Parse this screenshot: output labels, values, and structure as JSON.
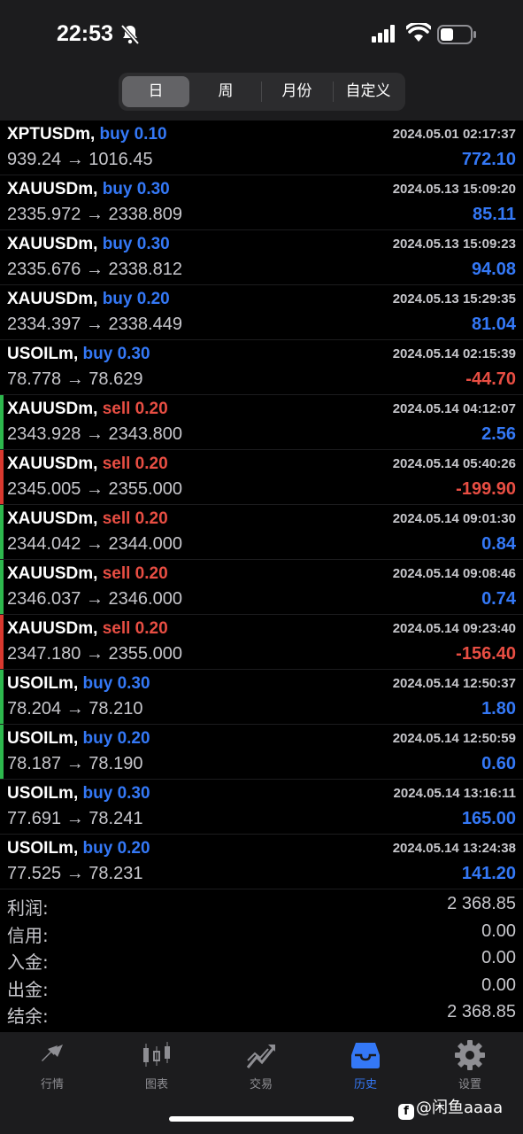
{
  "status": {
    "time": "22:53"
  },
  "segment": {
    "items": [
      "日",
      "周",
      "月份",
      "自定义"
    ],
    "active": 0
  },
  "deals": [
    {
      "symbol": "XPTUSDm",
      "side": "buy",
      "volume": "0.10",
      "datetime": "2024.05.01 02:17:37",
      "open": "939.24",
      "close": "1016.45",
      "profit": "772.10",
      "bar": ""
    },
    {
      "symbol": "XAUUSDm",
      "side": "buy",
      "volume": "0.30",
      "datetime": "2024.05.13 15:09:20",
      "open": "2335.972",
      "close": "2338.809",
      "profit": "85.11",
      "bar": ""
    },
    {
      "symbol": "XAUUSDm",
      "side": "buy",
      "volume": "0.30",
      "datetime": "2024.05.13 15:09:23",
      "open": "2335.676",
      "close": "2338.812",
      "profit": "94.08",
      "bar": ""
    },
    {
      "symbol": "XAUUSDm",
      "side": "buy",
      "volume": "0.20",
      "datetime": "2024.05.13 15:29:35",
      "open": "2334.397",
      "close": "2338.449",
      "profit": "81.04",
      "bar": ""
    },
    {
      "symbol": "USOILm",
      "side": "buy",
      "volume": "0.30",
      "datetime": "2024.05.14 02:15:39",
      "open": "78.778",
      "close": "78.629",
      "profit": "-44.70",
      "bar": ""
    },
    {
      "symbol": "XAUUSDm",
      "side": "sell",
      "volume": "0.20",
      "datetime": "2024.05.14 04:12:07",
      "open": "2343.928",
      "close": "2343.800",
      "profit": "2.56",
      "bar": "#2db84d"
    },
    {
      "symbol": "XAUUSDm",
      "side": "sell",
      "volume": "0.20",
      "datetime": "2024.05.14 05:40:26",
      "open": "2345.005",
      "close": "2355.000",
      "profit": "-199.90",
      "bar": "#d9392f"
    },
    {
      "symbol": "XAUUSDm",
      "side": "sell",
      "volume": "0.20",
      "datetime": "2024.05.14 09:01:30",
      "open": "2344.042",
      "close": "2344.000",
      "profit": "0.84",
      "bar": "#2db84d"
    },
    {
      "symbol": "XAUUSDm",
      "side": "sell",
      "volume": "0.20",
      "datetime": "2024.05.14 09:08:46",
      "open": "2346.037",
      "close": "2346.000",
      "profit": "0.74",
      "bar": "#2db84d"
    },
    {
      "symbol": "XAUUSDm",
      "side": "sell",
      "volume": "0.20",
      "datetime": "2024.05.14 09:23:40",
      "open": "2347.180",
      "close": "2355.000",
      "profit": "-156.40",
      "bar": "#d9392f"
    },
    {
      "symbol": "USOILm",
      "side": "buy",
      "volume": "0.30",
      "datetime": "2024.05.14 12:50:37",
      "open": "78.204",
      "close": "78.210",
      "profit": "1.80",
      "bar": "#2db84d"
    },
    {
      "symbol": "USOILm",
      "side": "buy",
      "volume": "0.20",
      "datetime": "2024.05.14 12:50:59",
      "open": "78.187",
      "close": "78.190",
      "profit": "0.60",
      "bar": "#2db84d"
    },
    {
      "symbol": "USOILm",
      "side": "buy",
      "volume": "0.30",
      "datetime": "2024.05.14 13:16:11",
      "open": "77.691",
      "close": "78.241",
      "profit": "165.00",
      "bar": ""
    },
    {
      "symbol": "USOILm",
      "side": "buy",
      "volume": "0.20",
      "datetime": "2024.05.14 13:24:38",
      "open": "77.525",
      "close": "78.231",
      "profit": "141.20",
      "bar": ""
    }
  ],
  "arrow": "→",
  "summary": [
    {
      "label": "利润:",
      "value": "2 368.85"
    },
    {
      "label": "信用:",
      "value": "0.00"
    },
    {
      "label": "入金:",
      "value": "0.00"
    },
    {
      "label": "出金:",
      "value": "0.00"
    },
    {
      "label": "结余:",
      "value": "2 368.85"
    }
  ],
  "tabs": [
    {
      "label": "行情",
      "icon": "quotes-arrows-icon"
    },
    {
      "label": "图表",
      "icon": "candlestick-chart-icon"
    },
    {
      "label": "交易",
      "icon": "trade-chart-icon"
    },
    {
      "label": "历史",
      "icon": "history-tray-icon"
    },
    {
      "label": "设置",
      "icon": "gear-icon"
    }
  ],
  "active_tab": 3,
  "colors": {
    "buy": "#3478f6",
    "sell": "#e84e43",
    "profit_positive": "#3478f6",
    "profit_negative": "#e84e43"
  },
  "watermark": "@闲鱼aaaa"
}
